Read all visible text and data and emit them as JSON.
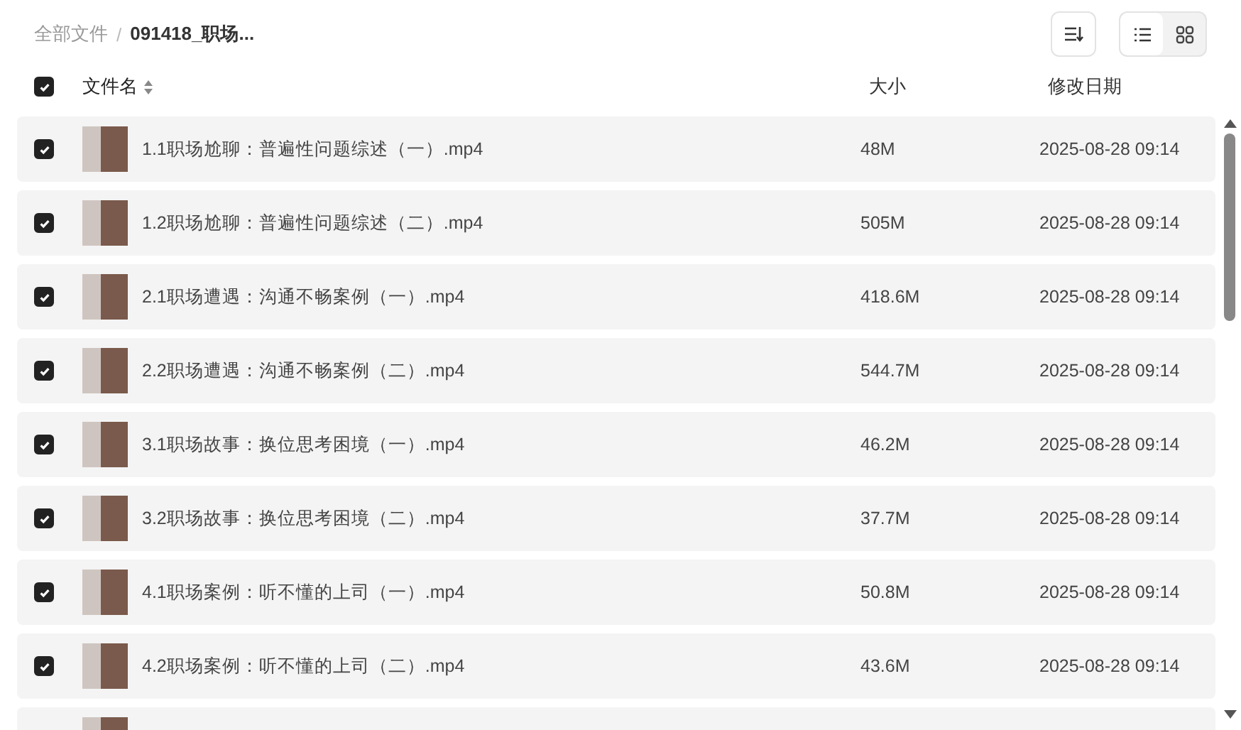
{
  "breadcrumb": {
    "separator": "/",
    "items": [
      {
        "label": "全部文件",
        "current": false
      },
      {
        "label": "091418_职场...",
        "current": true
      }
    ]
  },
  "toolbar": {
    "buttons": [
      {
        "kind": "sort"
      }
    ],
    "views": [
      {
        "kind": "list",
        "selected": true
      },
      {
        "kind": "grid",
        "selected": false
      }
    ]
  },
  "table": {
    "select_all": {
      "checked": true
    },
    "columns": [
      {
        "label": "文件名",
        "sortable": true
      },
      {
        "label": "大小",
        "sortable": false
      },
      {
        "label": "修改日期",
        "sortable": false
      }
    ],
    "rows": [
      {
        "kind": "file",
        "checked": true,
        "name": "1.1职场尬聊：普遍性问题综述（一）.mp4",
        "size": "48M",
        "date": "2025-08-28 09:14"
      },
      {
        "kind": "file",
        "checked": true,
        "name": "1.2职场尬聊：普遍性问题综述（二）.mp4",
        "size": "505M",
        "date": "2025-08-28 09:14"
      },
      {
        "kind": "file",
        "checked": true,
        "name": "2.1职场遭遇：沟通不畅案例（一）.mp4",
        "size": "418.6M",
        "date": "2025-08-28 09:14"
      },
      {
        "kind": "file",
        "checked": true,
        "name": "2.2职场遭遇：沟通不畅案例（二）.mp4",
        "size": "544.7M",
        "date": "2025-08-28 09:14"
      },
      {
        "kind": "file",
        "checked": true,
        "name": "3.1职场故事：换位思考困境（一）.mp4",
        "size": "46.2M",
        "date": "2025-08-28 09:14"
      },
      {
        "kind": "file",
        "checked": true,
        "name": "3.2职场故事：换位思考困境（二）.mp4",
        "size": "37.7M",
        "date": "2025-08-28 09:14"
      },
      {
        "kind": "file",
        "checked": true,
        "name": "4.1职场案例：听不懂的上司（一）.mp4",
        "size": "50.8M",
        "date": "2025-08-28 09:14"
      },
      {
        "kind": "file",
        "checked": true,
        "name": "4.2职场案例：听不懂的上司（二）.mp4",
        "size": "43.6M",
        "date": "2025-08-28 09:14"
      },
      {
        "kind": "partial"
      }
    ]
  }
}
